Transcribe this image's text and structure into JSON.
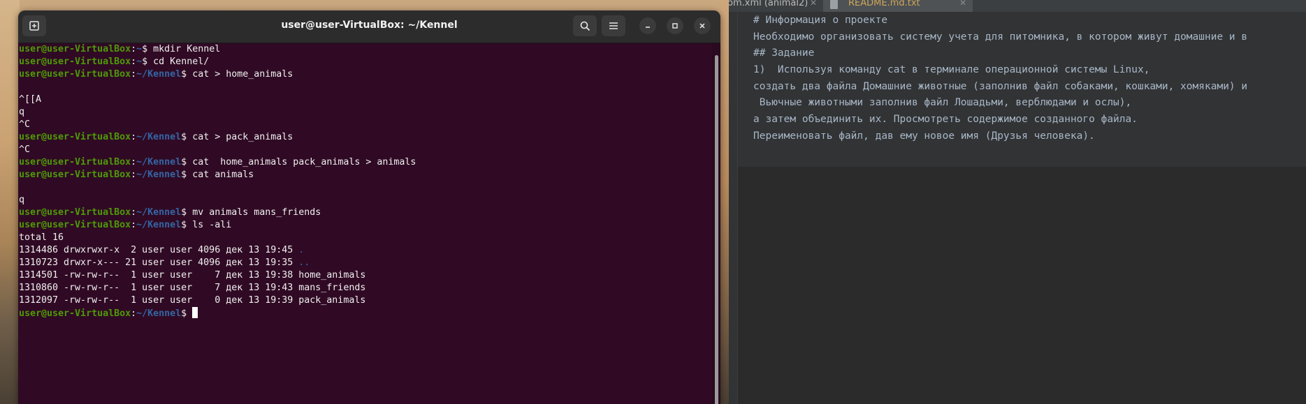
{
  "terminal": {
    "title": "user@user-VirtualBox: ~/Kennel",
    "prompt_user": "user@user-VirtualBox",
    "lines": [
      {
        "kind": "prompt",
        "path": "~",
        "cmd": " mkdir Kennel"
      },
      {
        "kind": "prompt",
        "path": "~",
        "cmd": " cd Kennel/"
      },
      {
        "kind": "prompt",
        "path": "~/Kennel",
        "cmd": " cat > home_animals"
      },
      {
        "kind": "text",
        "text": ""
      },
      {
        "kind": "text",
        "text": "^[[A"
      },
      {
        "kind": "text",
        "text": "q"
      },
      {
        "kind": "text",
        "text": "^C"
      },
      {
        "kind": "prompt",
        "path": "~/Kennel",
        "cmd": " cat > pack_animals"
      },
      {
        "kind": "text",
        "text": "^C"
      },
      {
        "kind": "prompt",
        "path": "~/Kennel",
        "cmd": " cat  home_animals pack_animals > animals"
      },
      {
        "kind": "prompt",
        "path": "~/Kennel",
        "cmd": " cat animals"
      },
      {
        "kind": "text",
        "text": ""
      },
      {
        "kind": "text",
        "text": "q"
      },
      {
        "kind": "prompt",
        "path": "~/Kennel",
        "cmd": " mv animals mans_friends"
      },
      {
        "kind": "prompt",
        "path": "~/Kennel",
        "cmd": " ls -ali"
      },
      {
        "kind": "text",
        "text": "total 16"
      },
      {
        "kind": "ls",
        "text": "1314486 drwxrwxr-x  2 user user 4096 дек 13 19:45 ",
        "name": "."
      },
      {
        "kind": "ls",
        "text": "1310723 drwxr-x--- 21 user user 4096 дек 13 19:35 ",
        "name": ".."
      },
      {
        "kind": "text",
        "text": "1314501 -rw-rw-r--  1 user user    7 дек 13 19:38 home_animals"
      },
      {
        "kind": "text",
        "text": "1310860 -rw-rw-r--  1 user user    7 дек 13 19:43 mans_friends"
      },
      {
        "kind": "text",
        "text": "1312097 -rw-rw-r--  1 user user    0 дек 13 19:39 pack_animals"
      },
      {
        "kind": "cursor",
        "path": "~/Kennel"
      }
    ],
    "colors": {
      "bg": "#300a24",
      "user": "#4e9a06",
      "path": "#3465a4"
    }
  },
  "editor": {
    "tabs": [
      {
        "label": "om.xml (animal2)"
      },
      {
        "label": "README.md.txt"
      }
    ],
    "lines": [
      "# Информация о проекте",
      "Необходимо организовать систему учета для питомника, в котором живут домашние и в",
      "## Задание",
      "1)  Используя команду cat в терминале операционной системы Linux,",
      "создать два файла Домашние животные (заполнив файл собаками, кошками, хомяками) и",
      " Вьючные животными заполнив файл Лошадьми, верблюдами и ослы),",
      "а затем объединить их. Просмотреть содержимое созданного файла.",
      "Переименовать файл, дав ему новое имя (Друзья человека)."
    ]
  }
}
